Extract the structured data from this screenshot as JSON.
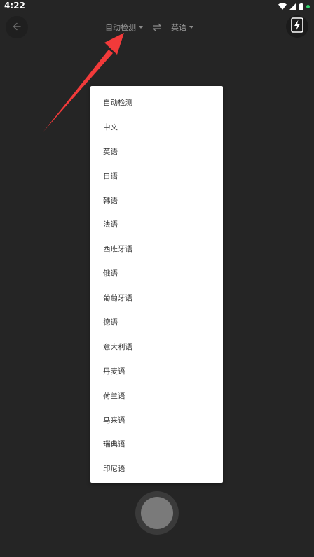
{
  "status_bar": {
    "time": "4:22"
  },
  "toolbar": {
    "back_icon": "back-arrow-icon",
    "flash_icon": "flash-icon",
    "swap_icon": "swap-icon"
  },
  "language_bar": {
    "source_language": "自动检测",
    "target_language": "英语"
  },
  "dropdown": {
    "items": [
      {
        "label": "自动检测"
      },
      {
        "label": "中文"
      },
      {
        "label": "英语"
      },
      {
        "label": "日语"
      },
      {
        "label": "韩语"
      },
      {
        "label": "法语"
      },
      {
        "label": "西班牙语"
      },
      {
        "label": "俄语"
      },
      {
        "label": "葡萄牙语"
      },
      {
        "label": "德语"
      },
      {
        "label": "意大利语"
      },
      {
        "label": "丹麦语"
      },
      {
        "label": "荷兰语"
      },
      {
        "label": "马来语"
      },
      {
        "label": "瑞典语"
      },
      {
        "label": "印尼语"
      }
    ]
  },
  "colors": {
    "background": "#252525",
    "menu_background": "#ffffff",
    "annotation_arrow": "#f23a3a",
    "status_dot": "#2fd36b"
  }
}
